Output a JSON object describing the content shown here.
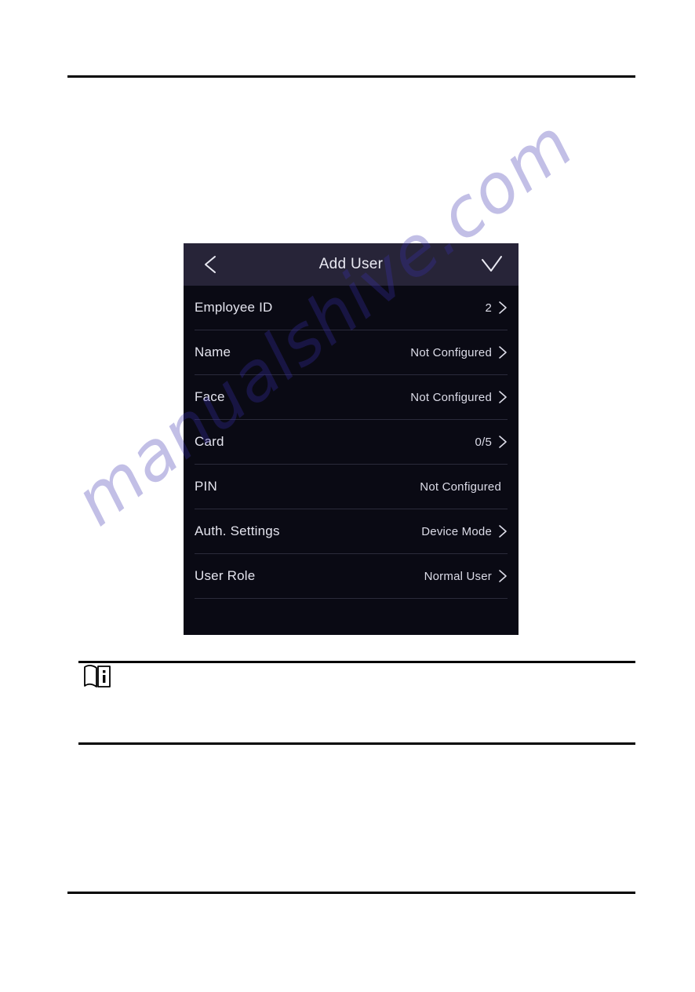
{
  "page": {
    "watermark": "manualshive.com"
  },
  "device": {
    "header": {
      "back_icon": "chevron-left-icon",
      "title": "Add User",
      "confirm_icon": "check-icon"
    },
    "rows": [
      {
        "label": "Employee ID",
        "value": "2",
        "chevron": true
      },
      {
        "label": "Name",
        "value": "Not Configured",
        "chevron": true
      },
      {
        "label": "Face",
        "value": "Not Configured",
        "chevron": true
      },
      {
        "label": "Card",
        "value": "0/5",
        "chevron": true
      },
      {
        "label": "PIN",
        "value": "Not Configured",
        "chevron": false
      },
      {
        "label": "Auth. Settings",
        "value": "Device Mode",
        "chevron": true
      },
      {
        "label": "User Role",
        "value": "Normal User",
        "chevron": true
      }
    ],
    "colors": {
      "header_bg": "#272438",
      "body_bg": "#0a0a14",
      "divider": "#2b2b3b",
      "text": "#e4e4ee"
    }
  },
  "note": {
    "icon": "note-book-info-icon",
    "text": ""
  }
}
